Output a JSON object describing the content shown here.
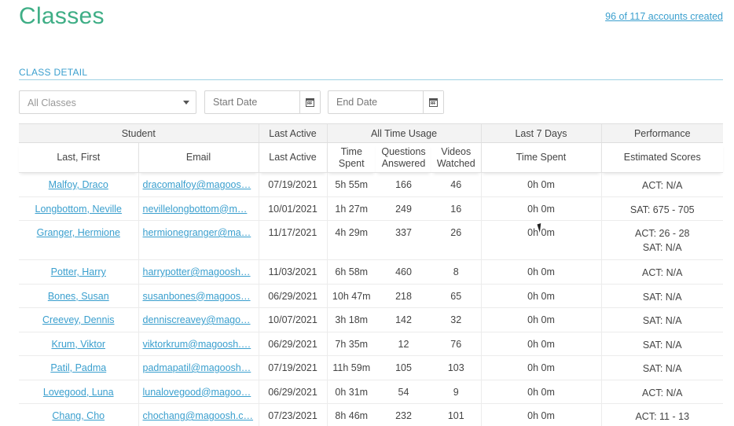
{
  "header": {
    "title": "Classes",
    "accounts_link": "96 of 117 accounts created"
  },
  "section": {
    "label": "CLASS DETAIL"
  },
  "filters": {
    "class_select": "All Classes",
    "start_date_placeholder": "Start Date",
    "end_date_placeholder": "End Date"
  },
  "table": {
    "groups": [
      "Student",
      "Last Active",
      "All Time Usage",
      "Last 7 Days",
      "Performance"
    ],
    "columns": [
      "Last, First",
      "Email",
      "Last Active",
      "Time\nSpent",
      "Questions\nAnswered",
      "Videos\nWatched",
      "Time Spent",
      "Estimated Scores"
    ],
    "rows": [
      {
        "name": "Malfoy, Draco",
        "email": "dracomalfoy@magoos…",
        "last_active": "07/19/2021",
        "time": "5h 55m",
        "questions": "166",
        "videos": "46",
        "week_time": "0h 0m",
        "scores": [
          "ACT: N/A"
        ]
      },
      {
        "name": "Longbottom, Neville",
        "email": "nevillelongbottom@m…",
        "last_active": "10/01/2021",
        "time": "1h 27m",
        "questions": "249",
        "videos": "16",
        "week_time": "0h 0m",
        "scores": [
          "SAT: 675 - 705"
        ]
      },
      {
        "name": "Granger, Hermione",
        "email": "hermionegranger@ma…",
        "last_active": "11/17/2021",
        "time": "4h 29m",
        "questions": "337",
        "videos": "26",
        "week_time": "0h 0m",
        "scores": [
          "ACT: 26 - 28",
          "SAT: N/A"
        ]
      },
      {
        "name": "Potter, Harry",
        "email": "harrypotter@magoosh…",
        "last_active": "11/03/2021",
        "time": "6h 58m",
        "questions": "460",
        "videos": "8",
        "week_time": "0h 0m",
        "scores": [
          "ACT: N/A"
        ]
      },
      {
        "name": "Bones, Susan",
        "email": "susanbones@magoos…",
        "last_active": "06/29/2021",
        "time": "10h 47m",
        "questions": "218",
        "videos": "65",
        "week_time": "0h 0m",
        "scores": [
          "SAT: N/A"
        ]
      },
      {
        "name": "Creevey, Dennis",
        "email": "denniscreavey@mago…",
        "last_active": "10/07/2021",
        "time": "3h 18m",
        "questions": "142",
        "videos": "32",
        "week_time": "0h 0m",
        "scores": [
          "SAT: N/A"
        ]
      },
      {
        "name": "Krum, Viktor",
        "email": "viktorkrum@magoosh.…",
        "last_active": "06/29/2021",
        "time": "7h 35m",
        "questions": "12",
        "videos": "76",
        "week_time": "0h 0m",
        "scores": [
          "SAT: N/A"
        ]
      },
      {
        "name": "Patil, Padma",
        "email": "padmapatil@magoosh…",
        "last_active": "07/19/2021",
        "time": "11h 59m",
        "questions": "105",
        "videos": "103",
        "week_time": "0h 0m",
        "scores": [
          "SAT: N/A"
        ]
      },
      {
        "name": "Lovegood, Luna",
        "email": "lunalovegood@magoo…",
        "last_active": "06/29/2021",
        "time": "0h 31m",
        "questions": "54",
        "videos": "9",
        "week_time": "0h 0m",
        "scores": [
          "ACT: N/A"
        ]
      },
      {
        "name": "Chang, Cho",
        "email": "chochang@magoosh.c…",
        "last_active": "07/23/2021",
        "time": "8h 46m",
        "questions": "232",
        "videos": "101",
        "week_time": "0h 0m",
        "scores": [
          "ACT: 11 - 13"
        ]
      }
    ]
  },
  "icons": {
    "select": "chevron-down-icon",
    "date": "calendar-icon",
    "pointer": "mouse-cursor-icon"
  },
  "colors": {
    "title_green": "#3fae86",
    "link_blue": "#3a9fce"
  }
}
